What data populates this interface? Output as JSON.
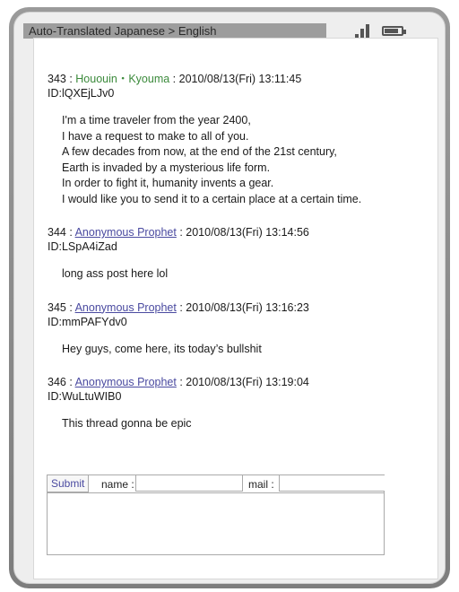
{
  "status_bar": {
    "title": "Auto-Translated  Japanese > English",
    "signal_icon": "signal-icon",
    "battery_icon": "battery-icon"
  },
  "posts": [
    {
      "number": "343",
      "name": "Hououin・Kyouma",
      "date": "2010/08/13(Fri) 13:11:45",
      "id": "ID:lQXEjLJv0",
      "lines": [
        "I'm a time traveler from the year 2400,",
        "I have a request to make to all of you.",
        "A few decades from now, at the end of the 21st century,",
        "Earth is invaded by a mysterious life form.",
        "In order to fight it, humanity invents a gear.",
        "I would like you to send it to a certain place at a certain time."
      ]
    },
    {
      "number": "344",
      "name": "Anonymous Prophet",
      "date": "2010/08/13(Fri) 13:14:56",
      "id": "ID:LSpA4iZad",
      "lines": [
        "long ass post here lol"
      ]
    },
    {
      "number": "345",
      "name": "Anonymous Prophet",
      "date": "2010/08/13(Fri) 13:16:23",
      "id": "ID:mmPAFYdv0",
      "lines": [
        "Hey guys, come here, its today’s bullshit"
      ]
    },
    {
      "number": "346",
      "name": "Anonymous Prophet",
      "date": "2010/08/13(Fri) 13:19:04",
      "id": "ID:WuLtuWIB0",
      "lines": [
        "This thread gonna be epic"
      ]
    }
  ],
  "form": {
    "submit_label": "Submit",
    "name_label": "name :",
    "mail_label": "mail :",
    "name_value": "",
    "mail_value": "",
    "comment_value": ""
  },
  "colors": {
    "trip_name": "#3b8a3b",
    "anon_name": "#4a4aa0",
    "status_bar": "#9d9d9d"
  }
}
